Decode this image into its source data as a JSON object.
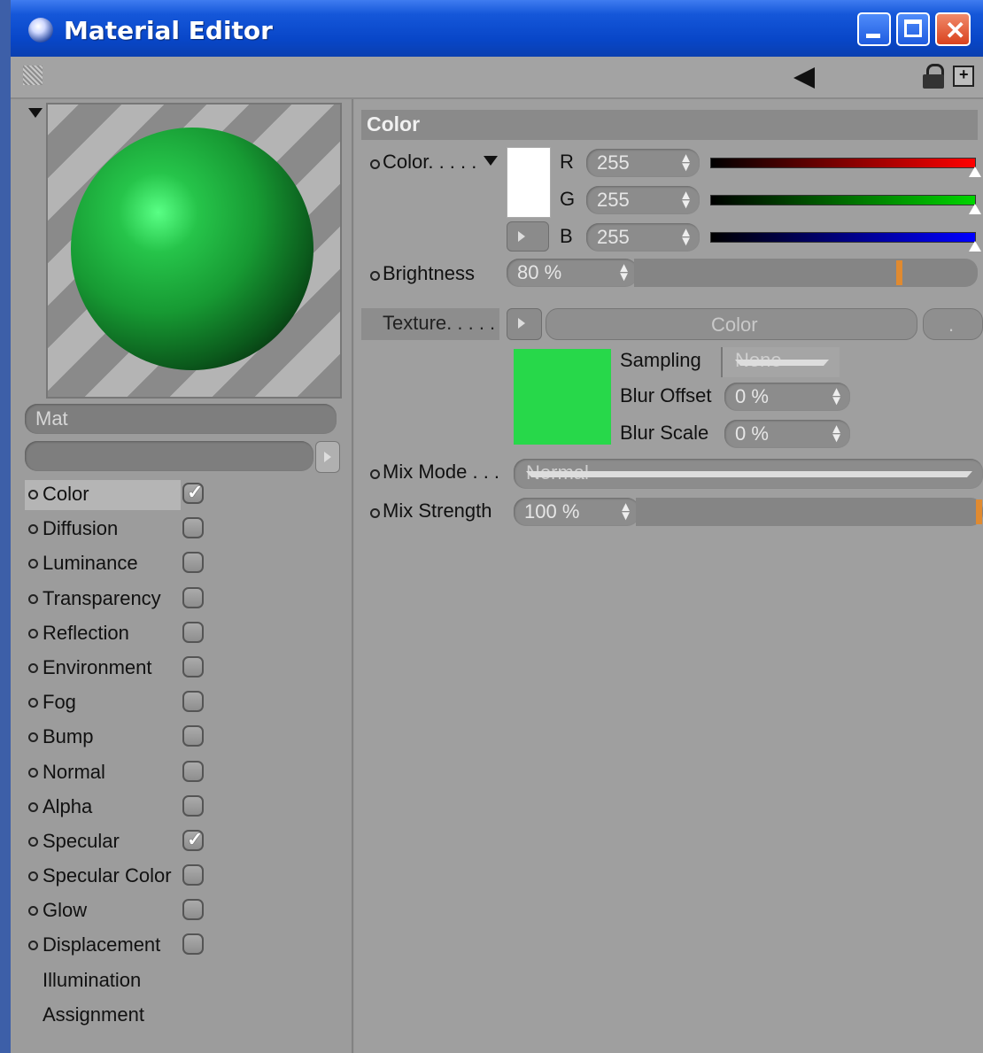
{
  "window": {
    "title": "Material Editor"
  },
  "material": {
    "name": "Mat"
  },
  "channels": [
    {
      "label": "Color",
      "checked": true,
      "selected": true
    },
    {
      "label": "Diffusion",
      "checked": false
    },
    {
      "label": "Luminance",
      "checked": false
    },
    {
      "label": "Transparency",
      "checked": false
    },
    {
      "label": "Reflection",
      "checked": false
    },
    {
      "label": "Environment",
      "checked": false
    },
    {
      "label": "Fog",
      "checked": false
    },
    {
      "label": "Bump",
      "checked": false
    },
    {
      "label": "Normal",
      "checked": false
    },
    {
      "label": "Alpha",
      "checked": false
    },
    {
      "label": "Specular",
      "checked": true
    },
    {
      "label": "Specular Color",
      "checked": false
    },
    {
      "label": "Glow",
      "checked": false
    },
    {
      "label": "Displacement",
      "checked": false
    }
  ],
  "extra_items": [
    "Illumination",
    "Assignment"
  ],
  "section": {
    "title": "Color"
  },
  "color": {
    "label": "Color. . . . .",
    "r_label": "R",
    "r": "255",
    "g_label": "G",
    "g": "255",
    "b_label": "B",
    "b": "255",
    "swatch_color": "#ffffff"
  },
  "brightness": {
    "label": "Brightness",
    "value": "80 %",
    "level_percent": 80
  },
  "texture": {
    "label": "Texture. . . . .",
    "name": "Color",
    "preview_color": "#27d84a",
    "sampling_label": "Sampling",
    "sampling_value": "None",
    "blur_offset_label": "Blur Offset",
    "blur_offset_value": "0 %",
    "blur_scale_label": "Blur Scale",
    "blur_scale_value": "0 %"
  },
  "mix": {
    "mode_label": "Mix Mode . . .",
    "mode_value": "Normal",
    "strength_label": "Mix Strength",
    "strength_value": "100 %",
    "strength_percent": 100
  },
  "checkmark_glyph": "✓",
  "dots": ". . . . . . . ."
}
